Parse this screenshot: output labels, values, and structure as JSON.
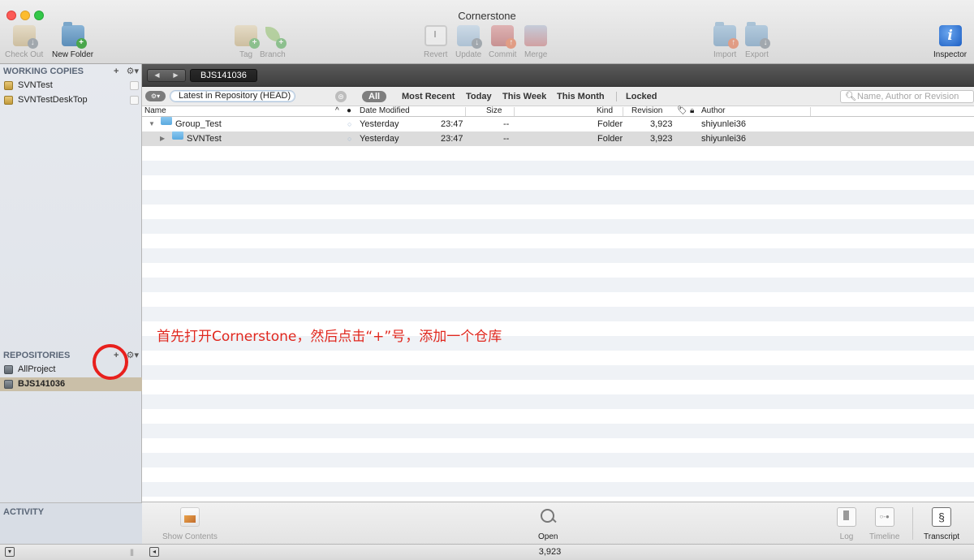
{
  "window": {
    "title": "Cornerstone"
  },
  "toolbar": {
    "checkout": "Check Out",
    "new_folder": "New Folder",
    "tag": "Tag",
    "branch": "Branch",
    "revert": "Revert",
    "update": "Update",
    "commit": "Commit",
    "merge": "Merge",
    "import": "Import",
    "export": "Export",
    "inspector": "Inspector"
  },
  "sidebar": {
    "working_copies_header": "WORKING COPIES",
    "working_copies": [
      "SVNTest",
      "SVNTestDeskTop"
    ],
    "repositories_header": "REPOSITORIES",
    "repositories": [
      "AllProject",
      "BJS141036"
    ],
    "selected_repository": "BJS141036",
    "activity_header": "ACTIVITY",
    "add_symbol": "+",
    "gear_symbol": "⚙▾"
  },
  "pathbar": {
    "crumb": "BJS141036"
  },
  "filters": {
    "scope_value": "Latest in Repository (HEAD)",
    "all": "All",
    "most_recent": "Most Recent",
    "today": "Today",
    "this_week": "This Week",
    "this_month": "This Month",
    "locked": "Locked",
    "search_placeholder": "Name, Author or Revision"
  },
  "columns": {
    "name": "Name",
    "date_modified": "Date Modified",
    "size": "Size",
    "kind": "Kind",
    "revision": "Revision",
    "author": "Author"
  },
  "rows": [
    {
      "name": "Group_Test",
      "date": "Yesterday",
      "time": "23:47",
      "size": "--",
      "kind": "Folder",
      "revision": "3,923",
      "author": "shiyunlei36",
      "expanded": true
    },
    {
      "name": "SVNTest",
      "date": "Yesterday",
      "time": "23:47",
      "size": "--",
      "kind": "Folder",
      "revision": "3,923",
      "author": "shiyunlei36",
      "expanded": false
    }
  ],
  "annotation": "首先打开Cornerstone，然后点击“+”号，添加一个仓库",
  "bottombar": {
    "show_contents": "Show Contents",
    "open": "Open",
    "log": "Log",
    "timeline": "Timeline",
    "transcript": "Transcript"
  },
  "statusbar": {
    "revision": "3,923"
  },
  "colors": {
    "annotation": "#e0281f",
    "selection": "#cabfa8"
  }
}
